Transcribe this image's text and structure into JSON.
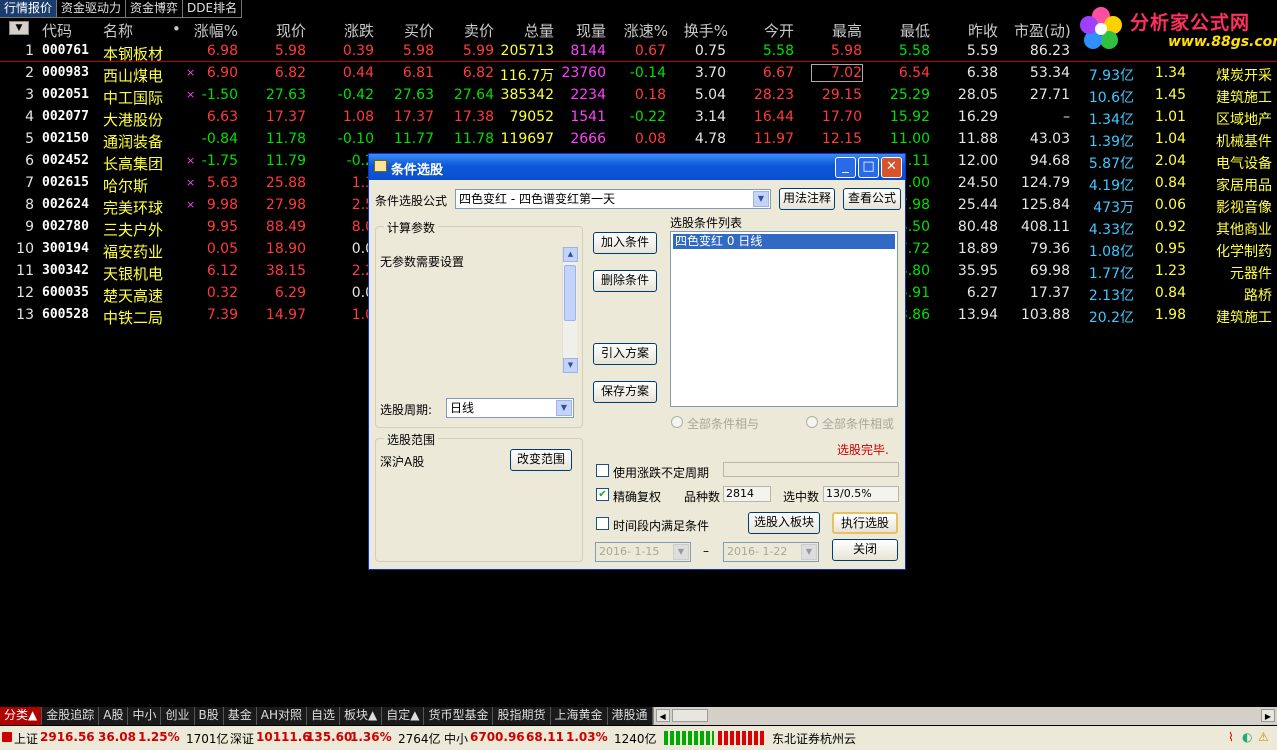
{
  "top_tabs": [
    "行情报价",
    "资金驱动力",
    "资金博弈",
    "DDE排名"
  ],
  "logo": {
    "title": "分析家公式网",
    "url": "www.88gs.com"
  },
  "header": {
    "code": "代码",
    "name": "名称",
    "dot": "•",
    "chg_pct": "涨幅%",
    "price": "现价",
    "change": "涨跌",
    "bid": "买价",
    "ask": "卖价",
    "volume": "总量",
    "cur_vol": "现量",
    "speed": "涨速%",
    "turnover": "换手%",
    "open": "今开",
    "high": "最高",
    "low": "最低",
    "prev_close": "昨收",
    "pe": "市盈(动)"
  },
  "rows": [
    {
      "n": "1",
      "code": "000761",
      "name": "本钢板材",
      "chg": "6.98",
      "price": "5.98",
      "change": "0.39",
      "bid": "5.98",
      "ask": "5.99",
      "vol": "205713",
      "cur": "8144",
      "spd": "0.67",
      "turn": "0.75",
      "open": "5.58",
      "high": "5.98",
      "low": "5.58",
      "prev": "5.59",
      "pe": "86.23",
      "cap": "",
      "ratio": "",
      "ind": ""
    },
    {
      "n": "2",
      "code": "000983",
      "name": "西山煤电",
      "chg": "6.90",
      "price": "6.82",
      "change": "0.44",
      "bid": "6.81",
      "ask": "6.82",
      "vol": "116.7万",
      "cur": "23760",
      "spd": "-0.14",
      "turn": "3.70",
      "open": "6.67",
      "high": "7.02",
      "low": "6.54",
      "prev": "6.38",
      "pe": "53.34",
      "cap": "7.93亿",
      "ratio": "1.34",
      "ind": "煤炭开采"
    },
    {
      "n": "3",
      "code": "002051",
      "name": "中工国际",
      "chg": "-1.50",
      "price": "27.63",
      "change": "-0.42",
      "bid": "27.63",
      "ask": "27.64",
      "vol": "385342",
      "cur": "2234",
      "spd": "0.18",
      "turn": "5.04",
      "open": "28.23",
      "high": "29.15",
      "low": "25.29",
      "prev": "28.05",
      "pe": "27.71",
      "cap": "10.6亿",
      "ratio": "1.45",
      "ind": "建筑施工"
    },
    {
      "n": "4",
      "code": "002077",
      "name": "大港股份",
      "chg": "6.63",
      "price": "17.37",
      "change": "1.08",
      "bid": "17.37",
      "ask": "17.38",
      "vol": "79052",
      "cur": "1541",
      "spd": "-0.22",
      "turn": "3.14",
      "open": "16.44",
      "high": "17.70",
      "low": "15.92",
      "prev": "16.29",
      "pe": "–",
      "cap": "1.34亿",
      "ratio": "1.01",
      "ind": "区域地产"
    },
    {
      "n": "5",
      "code": "002150",
      "name": "通润装备",
      "chg": "-0.84",
      "price": "11.78",
      "change": "-0.10",
      "bid": "11.77",
      "ask": "11.78",
      "vol": "119697",
      "cur": "2666",
      "spd": "0.08",
      "turn": "4.78",
      "open": "11.97",
      "high": "12.15",
      "low": "11.00",
      "prev": "11.88",
      "pe": "43.03",
      "cap": "1.39亿",
      "ratio": "1.04",
      "ind": "机械基件"
    },
    {
      "n": "6",
      "code": "002452",
      "name": "长高集团",
      "chg": "-1.75",
      "price": "11.79",
      "change": "-0.2",
      "low": ".11",
      "prev": "12.00",
      "pe": "94.68",
      "cap": "5.87亿",
      "ratio": "2.04",
      "ind": "电气设备"
    },
    {
      "n": "7",
      "code": "002615",
      "name": "哈尔斯",
      "chg": "5.63",
      "price": "25.88",
      "change": "1.3",
      "low": ".00",
      "prev": "24.50",
      "pe": "124.79",
      "cap": "4.19亿",
      "ratio": "0.84",
      "ind": "家居用品"
    },
    {
      "n": "8",
      "code": "002624",
      "name": "完美环球",
      "chg": "9.98",
      "price": "27.98",
      "change": "2.5",
      "low": "7.98",
      "prev": "25.44",
      "pe": "125.84",
      "cap": "473万",
      "ratio": "0.06",
      "ind": "影视音像"
    },
    {
      "n": "9",
      "code": "002780",
      "name": "三夫户外",
      "chg": "9.95",
      "price": "88.49",
      "change": "8.0",
      "low": "4.50",
      "prev": "80.48",
      "pe": "408.11",
      "cap": "4.33亿",
      "ratio": "0.92",
      "ind": "其他商业"
    },
    {
      "n": "10",
      "code": "300194",
      "name": "福安药业",
      "chg": "0.05",
      "price": "18.90",
      "change": "0.0",
      "low": "7.72",
      "prev": "18.89",
      "pe": "79.36",
      "cap": "1.08亿",
      "ratio": "0.95",
      "ind": "化学制药"
    },
    {
      "n": "11",
      "code": "300342",
      "name": "天银机电",
      "chg": "6.12",
      "price": "38.15",
      "change": "2.2",
      "low": "4.80",
      "prev": "35.95",
      "pe": "69.98",
      "cap": "1.77亿",
      "ratio": "1.23",
      "ind": "元器件"
    },
    {
      "n": "12",
      "code": "600035",
      "name": "楚天高速",
      "chg": "0.32",
      "price": "6.29",
      "change": "0.0",
      "low": "5.91",
      "prev": "6.27",
      "pe": "17.37",
      "cap": "2.13亿",
      "ratio": "0.84",
      "ind": "路桥"
    },
    {
      "n": "13",
      "code": "600528",
      "name": "中铁二局",
      "chg": "7.39",
      "price": "14.97",
      "change": "1.0",
      "low": "3.86",
      "prev": "13.94",
      "pe": "103.88",
      "cap": "20.2亿",
      "ratio": "1.98",
      "ind": "建筑施工"
    }
  ],
  "dialog": {
    "title": "条件选股",
    "formula_label": "条件选股公式",
    "formula_value": "四色变红 - 四色谱变红第一天",
    "usage_btn": "用法注释",
    "view_formula_btn": "查看公式",
    "params_group": "计算参数",
    "params_text": "无参数需要设置",
    "period_label": "选股周期:",
    "period_value": "日线",
    "list_title": "选股条件列表",
    "list_item": "四色变红  0  日线",
    "add_btn": "加入条件",
    "del_btn": "删除条件",
    "import_btn": "引入方案",
    "save_btn": "保存方案",
    "radio_and": "全部条件相与",
    "radio_or": "全部条件相或",
    "done_text": "选股完毕.",
    "range_group": "选股范围",
    "range_text": "深沪A股",
    "change_range_btn": "改变范围",
    "uncertain_period": "使用涨跌不定周期",
    "exact_rights": "精确复权",
    "variety_label": "品种数",
    "variety_value": "2814",
    "selected_label": "选中数",
    "selected_value": "13/0.5%",
    "time_range_label": "时间段内满足条件",
    "to_block_btn": "选股入板块",
    "execute_btn": "执行选股",
    "close_btn": "关闭",
    "date_from": "2016- 1-15",
    "date_dash": "–",
    "date_to": "2016- 1-22"
  },
  "bottom_tabs": [
    "分类▲",
    "金股追踪",
    "A股",
    "中小",
    "创业",
    "B股",
    "基金",
    "AH对照",
    "自选",
    "板块▲",
    "自定▲",
    "货币型基金",
    "股指期货",
    "上海黄金",
    "港股通"
  ],
  "status": {
    "sh_label": "上证",
    "sh_val": "2916.56",
    "sh_chg": "36.08",
    "sh_pct": "1.25%",
    "sh_amt": "1701亿",
    "sz_label": "深证",
    "sz_val": "10111.6",
    "sz_chg": "135.60",
    "sz_pct": "1.36%",
    "sz_amt": "2764亿",
    "zx_label": "中小",
    "zx_val": "6700.96",
    "zx_chg": "68.11",
    "zx_pct": "1.03%",
    "zx_amt": "1240亿",
    "broker": "东北证券杭州云"
  },
  "colors": {
    "up": "#ff3b3b",
    "down": "#00e000",
    "name": "#ffff40",
    "cap": "#40c8ff",
    "dialog_bg": "#ece9d8",
    "title_bar": "#0d58d8"
  }
}
